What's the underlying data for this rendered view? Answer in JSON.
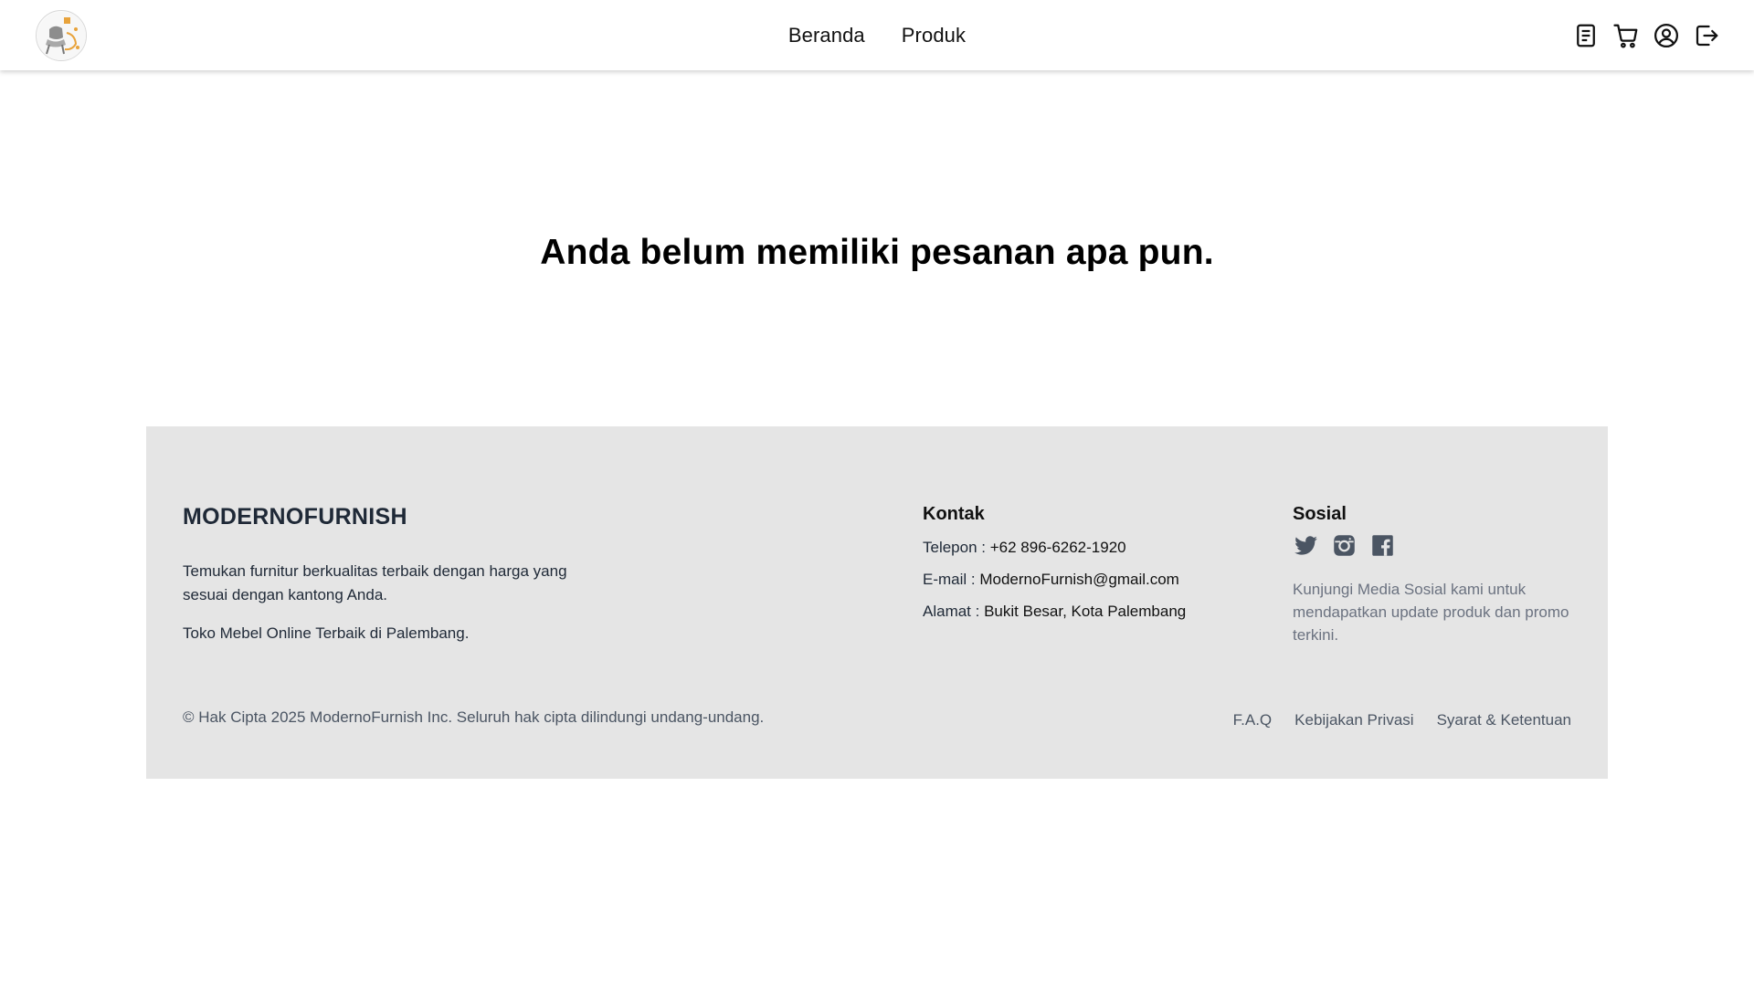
{
  "header": {
    "nav": [
      {
        "label": "Beranda"
      },
      {
        "label": "Produk"
      }
    ],
    "icons": [
      "orders-icon",
      "cart-icon",
      "user-icon",
      "logout-icon"
    ]
  },
  "main": {
    "empty_message": "Anda belum memiliki pesanan apa pun."
  },
  "footer": {
    "brand": "MODERNOFURNISH",
    "description": "Temukan furnitur berkualitas terbaik dengan harga yang sesuai dengan kantong Anda.",
    "tagline": "Toko Mebel Online Terbaik di Palembang.",
    "contact": {
      "title": "Kontak",
      "phone_label": "Telepon : ",
      "phone": "+62 896-6262-1920",
      "email_label": "E-mail : ",
      "email": "ModernoFurnish@gmail.com",
      "address_label": "Alamat : ",
      "address": "Bukit Besar, Kota Palembang"
    },
    "social": {
      "title": "Sosial",
      "icons": [
        "twitter-icon",
        "instagram-icon",
        "facebook-icon"
      ],
      "description": "Kunjungi Media Sosial kami untuk mendapatkan update produk dan promo terkini."
    },
    "copyright": "© Hak Cipta 2025 ModernoFurnish Inc. Seluruh hak cipta dilindungi undang-undang.",
    "links": [
      {
        "label": "F.A.Q"
      },
      {
        "label": "Kebijakan Privasi"
      },
      {
        "label": "Syarat & Ketentuan"
      }
    ]
  },
  "colors": {
    "footer_bg": "#e5e5e5",
    "brand_text": "#1f2937",
    "muted_text": "#6b7280"
  }
}
